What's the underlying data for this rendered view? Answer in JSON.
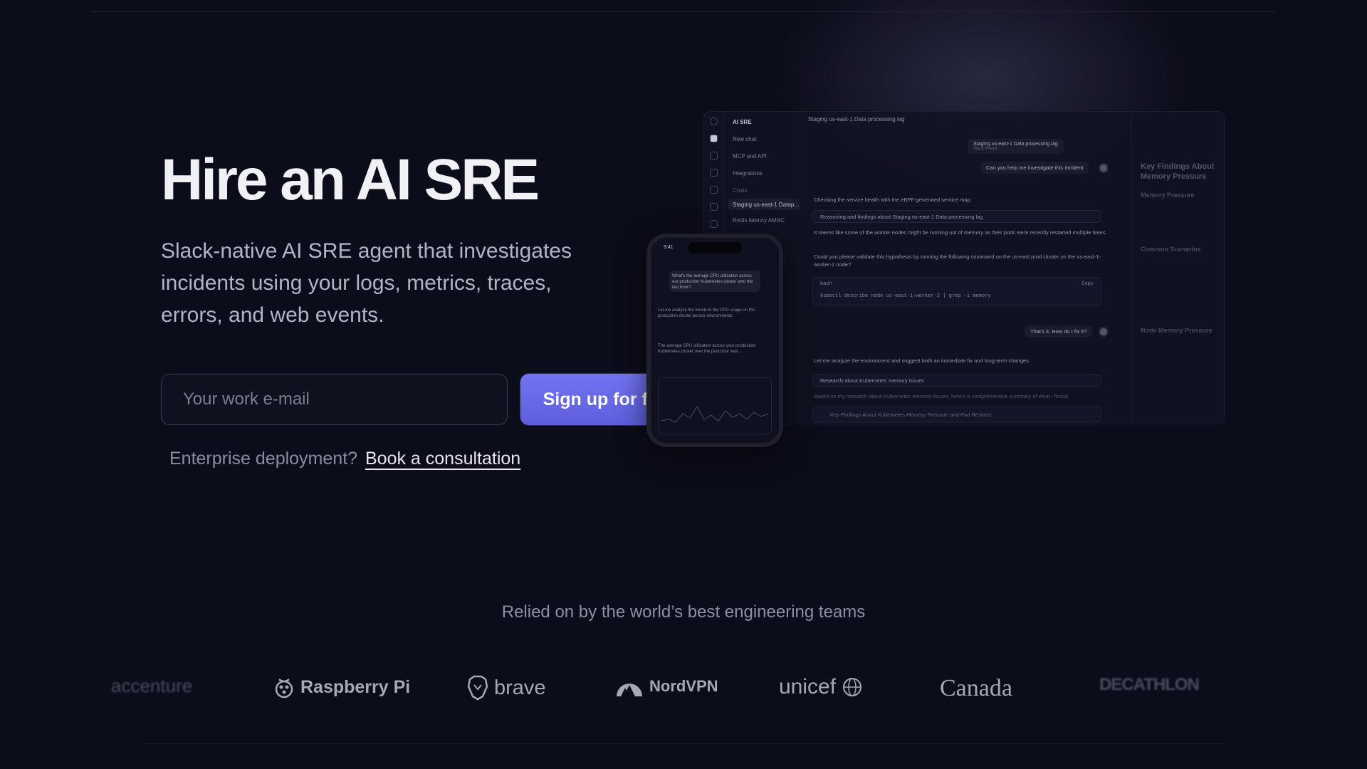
{
  "hero": {
    "title": "Hire an AI SRE",
    "subtitle": "Slack-native AI SRE agent that investigates incidents using your logs, metrics, traces, errors, and web events.",
    "email_placeholder": "Your work e-mail",
    "signup_label": "Sign up for free",
    "enterprise_text": "Enterprise deployment?",
    "consultation_link": "Book a consultation"
  },
  "mock": {
    "app_name": "AI SRE",
    "header": "Staging us-east-1 Data processing lag",
    "sidebar": {
      "items": [
        "New chat",
        "MCP and API",
        "Integrations"
      ],
      "chats_label": "Chats",
      "chats": [
        "Staging us-east-1 Datap…",
        "Redis latency AMAC"
      ]
    },
    "incident_title": "Staging us-east-1 Data processing lag",
    "incident_status": "Slack thread",
    "user_message": "Can you help me investigate this incident",
    "agent_line1": "Checking the service health with the eBPF-generated service map.",
    "search_line": "Reasoning and findings about Staging us-east-1 Data processing lag",
    "agent_line2": "It seems like some of the worker nodes might be running out of memory as their pods were recently restarted multiple times.",
    "agent_line3": "Could you please validate this hypothesis by running the following command on the us-east prod cluster on the us-east-1-worker-2 node?",
    "code_lang": "bash",
    "code_copy": "Copy",
    "code_line": "kubectl describe node us-east-1-worker-2 | grep -i memory",
    "user_message2": "That's it. How do I fix it?",
    "agent_line4": "Let me analyze the environment and suggest both an immediate fix and long-term changes.",
    "search_line2": "Research about Kubernetes memory issues",
    "agent_line5": "Based on my research about Kubernetes memory issues, here's a comprehensive summary of what I found:",
    "findings_line": "Key Findings About Kubernetes Memory Pressure and Pod Restarts",
    "panel": {
      "heading": "Key Findings About Memory Pressure",
      "sec1": "Memory Pressure",
      "sec2": "Common Scenarios",
      "sec3": "Node Memory Pressure"
    }
  },
  "phone": {
    "time": "9:41",
    "question": "What's the average CPU utilization across our production Kubernetes cluster over the last hour?",
    "answer": "Let me analyze the trends in the CPU usage on the production cluster across environments.",
    "summary": "The average CPU utilization across your production Kubernetes cluster over the past hour was…"
  },
  "logos": {
    "heading": "Relied on by the world’s best engineering teams",
    "items": [
      {
        "name": "accenture",
        "icon": "accenture-icon"
      },
      {
        "name": "Raspberry Pi",
        "icon": "raspberry-icon"
      },
      {
        "name": "brave",
        "icon": "brave-lion-icon"
      },
      {
        "name": "NordVPN",
        "icon": "nord-mountain-icon"
      },
      {
        "name": "unicef",
        "icon": "unicef-globe-icon"
      },
      {
        "name": "Canada",
        "icon": "canada-icon"
      },
      {
        "name": "DECATHLON",
        "icon": "decathlon-icon"
      }
    ]
  },
  "colors": {
    "background": "#0c0d1a",
    "accent": "#6566e8",
    "text_primary": "#f1f1f5",
    "text_secondary": "#b2b4c4"
  }
}
